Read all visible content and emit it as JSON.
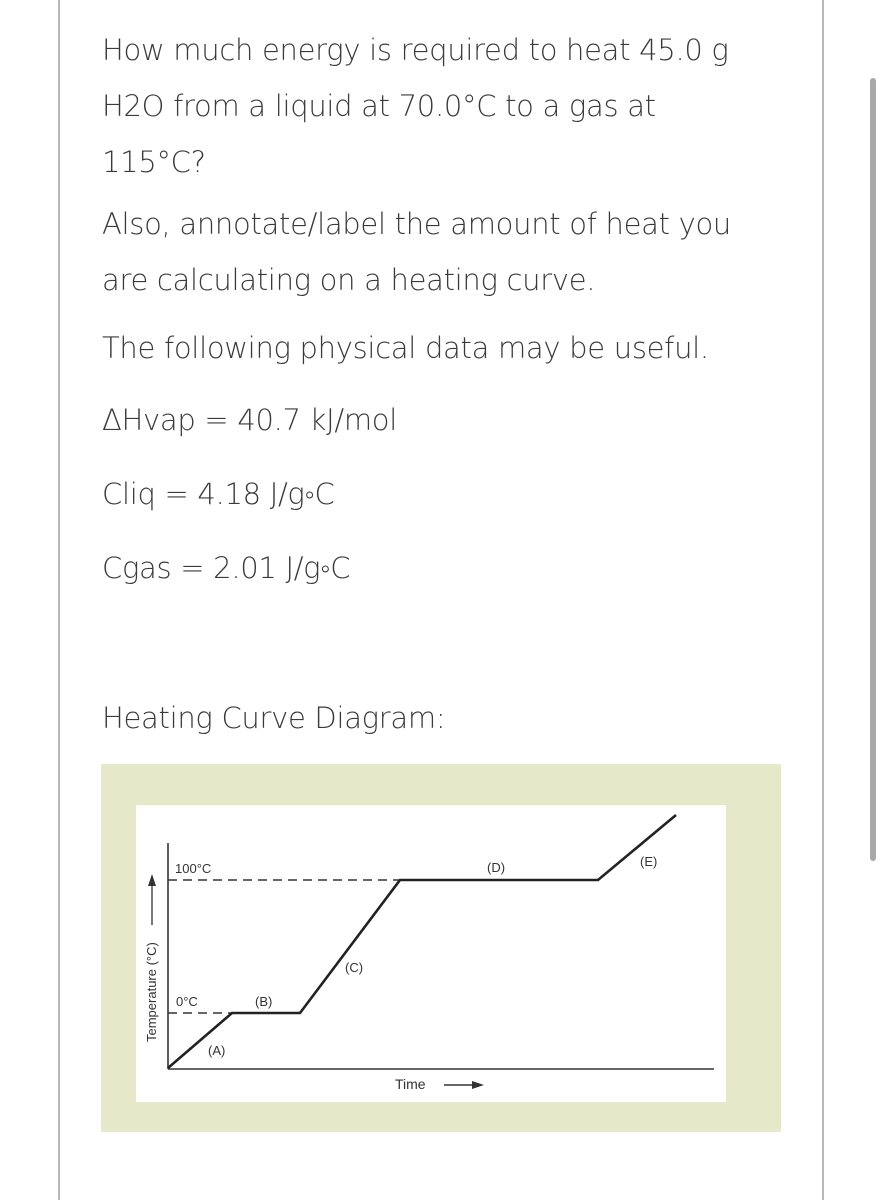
{
  "question": {
    "line1": "How much energy is required to heat 45.0 g",
    "line2": "H2O from a liquid at 70.0°C to a gas at",
    "line3": "115°C?",
    "annotate_line1": "Also, annotate/label the amount of heat you",
    "annotate_line2": "are calculating on a heating curve.",
    "data_intro": "The following physical data may be useful."
  },
  "physical_data": [
    {
      "label": "ΔHvap = 40.7 kJ/mol"
    },
    {
      "label": "Cliq = 4.18 J/g◦C"
    },
    {
      "label": "Cgas = 2.01 J/g◦C"
    }
  ],
  "diagram_heading": "Heating Curve Diagram:",
  "diagram": {
    "y_axis_label": "Temperature (°C)",
    "x_axis_label": "Time",
    "levels": [
      {
        "label": "100°C",
        "value": 100
      },
      {
        "label": "0°C",
        "value": 0
      }
    ],
    "segments": [
      {
        "label": "(A)",
        "phase": "solid heating",
        "from_temp": "below 0",
        "to_temp": 0
      },
      {
        "label": "(B)",
        "phase": "melting",
        "temp": 0
      },
      {
        "label": "(C)",
        "phase": "liquid heating",
        "from_temp": 0,
        "to_temp": 100
      },
      {
        "label": "(D)",
        "phase": "vaporization",
        "temp": 100
      },
      {
        "label": "(E)",
        "phase": "gas heating",
        "from_temp": 100,
        "to_temp": "above 100"
      }
    ],
    "colors": {
      "frame": "#e5e9c9",
      "line": "#222222"
    }
  }
}
